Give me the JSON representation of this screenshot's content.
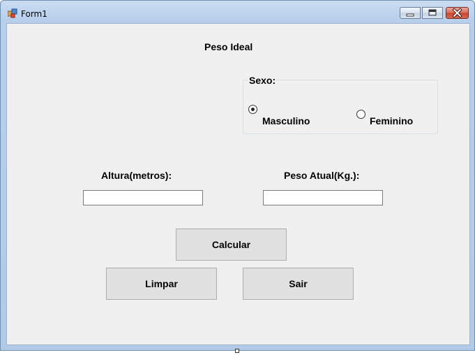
{
  "window": {
    "title": "Form1"
  },
  "form": {
    "heading": "Peso Ideal",
    "sexo_group": {
      "legend": "Sexo:",
      "options": [
        {
          "label": "Masculino",
          "selected": true
        },
        {
          "label": "Feminino",
          "selected": false
        }
      ]
    },
    "altura_label": "Altura(metros):",
    "altura_value": "",
    "peso_label": "Peso Atual(Kg.):",
    "peso_value": "",
    "buttons": {
      "calcular": "Calcular",
      "limpar": "Limpar",
      "sair": "Sair"
    }
  },
  "icons": {
    "app": "form-app-icon",
    "minimize": "minimize-icon",
    "maximize": "maximize-icon",
    "close": "close-icon"
  },
  "colors": {
    "client_bg": "#f0f0f0",
    "button_bg": "#e1e1e1",
    "close_button": "#c8432e",
    "titlebar": "#c9dcf2"
  }
}
